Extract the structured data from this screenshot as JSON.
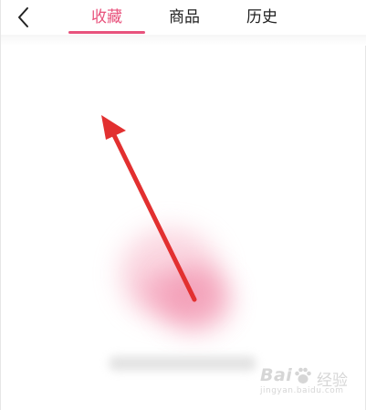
{
  "colors": {
    "accent": "#e8527c",
    "text": "#222222",
    "arrow": "#e23030"
  },
  "header": {
    "back_icon": "chevron-left-icon",
    "tabs": [
      {
        "label": "收藏",
        "active": true
      },
      {
        "label": "商品",
        "active": false
      },
      {
        "label": "历史",
        "active": false
      }
    ]
  },
  "watermark": {
    "brand_left": "Bai",
    "brand_icon": "paw-icon",
    "brand_right": "经验",
    "url": "jingyan.baidu.com"
  }
}
